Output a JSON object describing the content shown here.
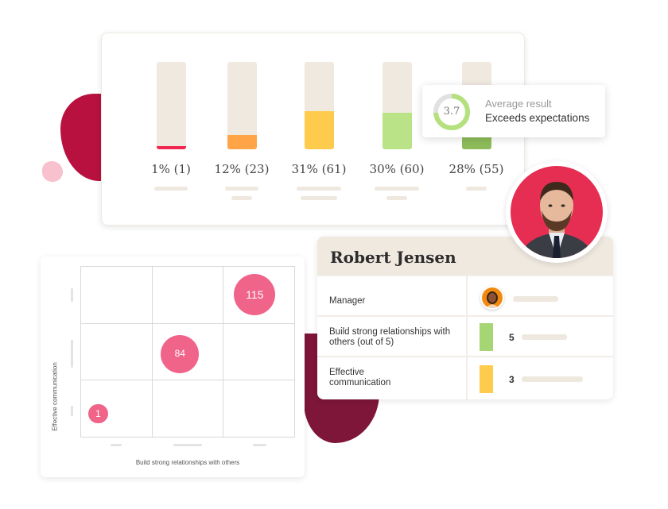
{
  "results_card": {
    "bars": [
      {
        "label": "1% (1)",
        "percent": 1,
        "count": 1,
        "color": "#f2274f"
      },
      {
        "label": "12% (23)",
        "percent": 12,
        "count": 23,
        "color": "#ffa447"
      },
      {
        "label": "31% (61)",
        "percent": 31,
        "count": 61,
        "color": "#ffcb4c"
      },
      {
        "label": "30% (60)",
        "percent": 30,
        "count": 60,
        "color": "#bae287"
      },
      {
        "label": "28% (55)",
        "percent": 28,
        "count": 55,
        "color": "#8dbb59"
      }
    ],
    "track_color": "#f0e9e0"
  },
  "tooltip": {
    "value": "3.7",
    "max": 5,
    "title": "Average result",
    "subtitle": "Exceeds expectations",
    "ring_color": "#b4e07e",
    "ring_bg": "#e1e1e1"
  },
  "profile": {
    "name": "Robert Jensen",
    "rows": [
      {
        "label": "Manager"
      },
      {
        "label": "Build strong relationships with others (out of 5)",
        "score": "5",
        "color": "#a6d574"
      },
      {
        "label": "Effective communication",
        "score": "3",
        "color": "#ffcb4c"
      }
    ]
  },
  "matrix": {
    "x_label": "Build strong relationships with others",
    "y_label": "Effective communication",
    "bubbles": [
      {
        "value": "115",
        "col": 2,
        "row": 0
      },
      {
        "value": "84",
        "col": 1,
        "row": 1
      },
      {
        "value": "1",
        "col": 0,
        "row": 2
      }
    ],
    "bubble_color": "#f0648a"
  },
  "brand_colors": {
    "crimson": "#b8113f",
    "wine": "#7d1638",
    "pink": "#f7c1cd",
    "photo_bg": "#e62d52"
  }
}
